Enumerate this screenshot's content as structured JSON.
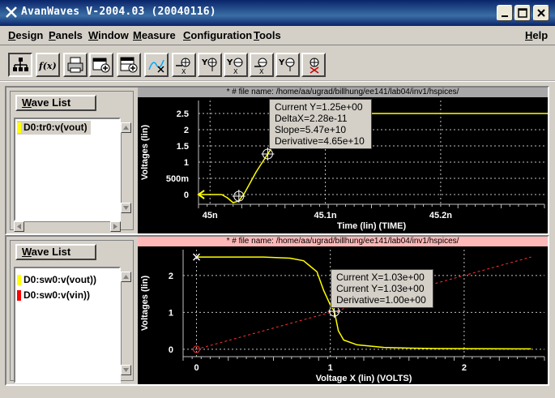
{
  "window": {
    "title": "AvanWaves V-2004.03 (20040116)"
  },
  "menu": {
    "items": [
      {
        "label": "Design",
        "underline": "D",
        "rest": "esign"
      },
      {
        "label": "Panels",
        "underline": "P",
        "rest": "anels"
      },
      {
        "label": "Window",
        "underline": "W",
        "rest": "indow"
      },
      {
        "label": "Measure",
        "underline": "M",
        "rest": "easure"
      },
      {
        "label": "Configuration",
        "underline": "C",
        "rest": "onfiguration"
      },
      {
        "label": "Tools",
        "underline": "T",
        "rest": "ools"
      }
    ],
    "help": {
      "label": "Help",
      "underline": "H",
      "rest": "elp"
    }
  },
  "toolbar": {
    "buttons": [
      {
        "name": "hierarchy-icon"
      },
      {
        "name": "function-icon",
        "text": "f(x)"
      },
      {
        "name": "print-icon"
      },
      {
        "name": "add-panel-icon"
      },
      {
        "name": "add-panels-icon"
      },
      {
        "name": "delete-waves-icon"
      },
      {
        "name": "measure-x-icon"
      },
      {
        "name": "measure-y-icon"
      },
      {
        "name": "measure-xy-icon"
      },
      {
        "name": "delta-x-icon"
      },
      {
        "name": "delta-y-icon"
      },
      {
        "name": "clear-measure-icon"
      }
    ]
  },
  "panel_top": {
    "wave_list_label": "Wave List",
    "wave_list_underline": "W",
    "wave_list_rest": "ave List",
    "waves": [
      {
        "label": "D0:tr0:v(vout)",
        "color": "#ffff00",
        "selected": true
      }
    ],
    "file_header": "* # file name: /home/aa/ugrad/billhung/ee141/lab04/inv1/hspices/",
    "header_bg": "#a8a8a8",
    "tooltip": [
      "Current Y=1.25e+00",
      "DeltaX=2.28e-11",
      "Slope=5.47e+10",
      "Derivative=4.65e+10"
    ]
  },
  "panel_bottom": {
    "wave_list_label": "Wave List",
    "wave_list_underline": "W",
    "wave_list_rest": "ave List",
    "waves": [
      {
        "label": "D0:sw0:v(vout))",
        "color": "#ffff00",
        "selected": false
      },
      {
        "label": "D0:sw0:v(vin))",
        "color": "#ff0000",
        "selected": false
      }
    ],
    "file_header": "* # file name: /home/aa/ugrad/billhung/ee141/lab04/inv1/hspices/",
    "header_bg": "#ffb8b8",
    "tooltip": [
      "Current X=1.03e+00",
      "Current Y=1.03e+00",
      "Derivative=1.00e+00"
    ]
  },
  "chart_data": [
    {
      "type": "line",
      "xlabel": "Time (lin) (TIME)",
      "ylabel": "Voltages (lin)",
      "x_ticks": [
        "45n",
        "45.1n",
        "45.2n"
      ],
      "y_ticks": [
        "0",
        "500m",
        "1",
        "1.5",
        "2",
        "2.5"
      ],
      "ylim": [
        -0.3,
        2.9
      ],
      "grid": true,
      "series": [
        {
          "name": "D0:tr0:v(vout)",
          "color": "#ffff00",
          "x_ns": [
            44.99,
            45.0,
            45.01,
            45.015,
            45.02,
            45.025,
            45.03,
            45.04,
            45.05,
            45.06,
            45.07,
            45.08,
            45.1,
            45.2,
            45.3
          ],
          "y": [
            0,
            0,
            0,
            -0.1,
            -0.25,
            -0.2,
            0.05,
            0.7,
            1.25,
            1.8,
            2.25,
            2.45,
            2.5,
            2.5,
            2.5
          ]
        }
      ]
    },
    {
      "type": "line",
      "xlabel": "Voltage X (lin) (VOLTS)",
      "ylabel": "Voltages (lin)",
      "x_ticks": [
        "0",
        "1",
        "2"
      ],
      "y_ticks": [
        "0",
        "1",
        "2"
      ],
      "xlim": [
        -0.1,
        2.6
      ],
      "ylim": [
        -0.2,
        2.7
      ],
      "grid": true,
      "series": [
        {
          "name": "D0:sw0:v(vout))",
          "color": "#ffff00",
          "x": [
            0,
            0.5,
            0.7,
            0.8,
            0.9,
            0.95,
            1.0,
            1.03,
            1.06,
            1.1,
            1.2,
            1.4,
            1.6,
            1.8,
            2.5
          ],
          "y": [
            2.5,
            2.5,
            2.47,
            2.4,
            2.1,
            1.6,
            1.2,
            1.03,
            0.5,
            0.25,
            0.12,
            0.05,
            0.03,
            0.02,
            0.01
          ]
        },
        {
          "name": "D0:sw0:v(vin))",
          "color": "#ff3030",
          "x": [
            0,
            2.5
          ],
          "y": [
            0,
            2.5
          ]
        }
      ]
    }
  ]
}
